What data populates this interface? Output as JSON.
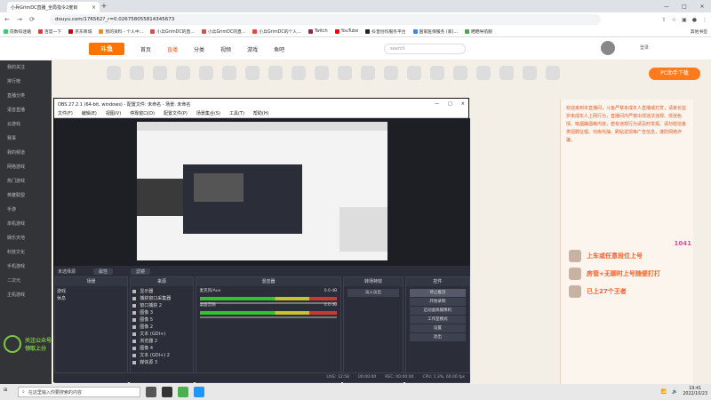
{
  "browser": {
    "tab_title": "小兵GrimDC直播_全局指令2度目",
    "newtab_label": "+",
    "url": "douyu.com/176562?_r=0.02675805581434567​3",
    "bookmarks": [
      "前数码迷籍",
      "百度一下",
      "京东商城",
      "我的资料 - 个人中...",
      "小兵GrimDC的直...",
      "小兵GrimDC的直...",
      "小兵GrimDC的个人...",
      "Twitch",
      "YouTube",
      "抖音创作服务平台",
      "国家医保服务 (家)...",
      "晒晒导航服"
    ],
    "bookmark_right": "其他书签"
  },
  "site": {
    "logo": "斗鱼",
    "nav": [
      "首页",
      "直播",
      "分类",
      "视频",
      "游戏",
      "鱼吧"
    ],
    "nav_active_index": 1,
    "search_placeholder": "search",
    "login": "登录",
    "pk_button": "PC助手下载",
    "left_nav": [
      "我的关注",
      "排行榜",
      "直播分类",
      "语音直播",
      "云游戏",
      "赛事",
      "我的频道",
      "网络游戏",
      "热门游戏",
      "英雄联盟",
      "手游",
      "单机游戏",
      "娱乐天地",
      "科技文化",
      "手机游戏",
      "二次元",
      "主机游戏"
    ],
    "right_panel_text": "欢迎来到本直播间，斗鱼严禁未成年人直播或打赏，请家长监护未成年人上网行为，直播间内严禁出现违法违规、低俗色情、吸烟酗酒等内容，若有违规行为请及时举报。请勿轻信各类招聘征婚、代练代抽、刷钻返现等广告信息，谨防网络诈骗。",
    "chat_lines": [
      "上车或任意段位上号",
      "房管+无聊时上号随便打打",
      "已上27个王者"
    ],
    "chat_level": "1041"
  },
  "watermark": {
    "line1": "关注公众号 GrimDC",
    "line2": "领取上分"
  },
  "obs": {
    "title": "OBS 27.2.1 (64-bit, windows) - 配置文件: 未命名 - 场景: 未命名",
    "menu": [
      "文件(F)",
      "编辑(E)",
      "视图(V)",
      "停靠窗口(D)",
      "配置文件(P)",
      "场景集合(S)",
      "工具(T)",
      "帮助(H)"
    ],
    "no_source": "未选择源",
    "props_btn": "属性",
    "filters_btn": "滤镜",
    "docks": {
      "scenes_title": "场景",
      "scenes": [
        "游戏",
        "休息"
      ],
      "sources_title": "来源",
      "sources": [
        "显示器",
        "捕获窗口采集器",
        "窗口捕获 2",
        "图像 3",
        "图像 5",
        "图像 2",
        "文本 (GDI+)",
        "浏览器 2",
        "图像 4",
        "文本 (GDI+) 2",
        "媒体源 3"
      ],
      "mixer_title": "混音器",
      "mixer": [
        {
          "name": "麦克风/Aux",
          "db": "0.0 dB"
        },
        {
          "name": "桌面音频",
          "db": "0.0 dB"
        }
      ],
      "transition_title": "转场特效",
      "transition_value": "淡入淡出",
      "controls_title": "控件",
      "controls": [
        "停止推流",
        "开始录制",
        "启动虚拟摄像机",
        "工作室模式",
        "设置",
        "退出"
      ]
    },
    "status": [
      "LIVE: 12:58",
      "00:00:00",
      "REC: 00:00:00",
      "CPU: 1.3%, 60.00 fps"
    ]
  },
  "taskbar": {
    "search": "在这里输入你要搜索的内容",
    "time": "19:41",
    "date": "2022/10/23"
  }
}
